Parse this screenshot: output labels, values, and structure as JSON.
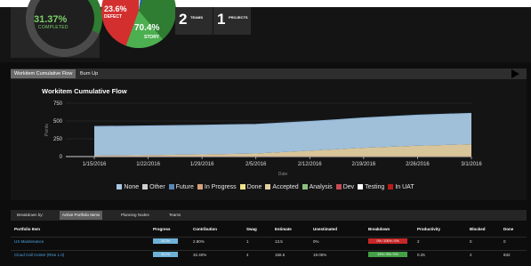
{
  "summary": {
    "gauge": {
      "value": "31.37%",
      "label": "COMPLETED"
    },
    "pie": {
      "slices": [
        {
          "name": "defect",
          "value": "23.6%",
          "label": "DEFECT",
          "color": "#d32f2f"
        },
        {
          "name": "story",
          "value": "70.4%",
          "label": "STORY",
          "color": "#4caf50"
        }
      ]
    },
    "tiles": [
      {
        "num": "2",
        "label": "TEAMS"
      },
      {
        "num": "1",
        "label": "PROJECTS"
      }
    ]
  },
  "chart_tabs": [
    "Workitem Cumulative Flow",
    "Burn Up"
  ],
  "chart_data": {
    "type": "area",
    "title": "Workitem Cumulative Flow",
    "xlabel": "Date",
    "ylabel": "Points",
    "ylim": [
      0,
      750
    ],
    "yticks": [
      0,
      250,
      500,
      750
    ],
    "x": [
      "1/15/2016",
      "1/22/2016",
      "1/29/2016",
      "2/5/2016",
      "2/12/2016",
      "2/19/2016",
      "2/26/2016",
      "3/1/2016"
    ],
    "series": [
      {
        "name": "None",
        "color": "#a8c8e4",
        "values": [
          410,
          410,
          410,
          410,
          410,
          420,
          430,
          435
        ]
      },
      {
        "name": "Other",
        "color": "#cfcfcf",
        "values": [
          0,
          0,
          0,
          0,
          0,
          0,
          0,
          0
        ]
      },
      {
        "name": "Future",
        "color": "#5a86b8",
        "values": [
          0,
          0,
          0,
          0,
          0,
          0,
          0,
          0
        ]
      },
      {
        "name": "In Progress",
        "color": "#d7a17a",
        "values": [
          0,
          0,
          0,
          0,
          0,
          0,
          0,
          0
        ]
      },
      {
        "name": "Done",
        "color": "#efe08a",
        "values": [
          0,
          0,
          0,
          0,
          0,
          0,
          0,
          0
        ]
      },
      {
        "name": "Accepted",
        "color": "#e3cfa0",
        "values": [
          10,
          18,
          28,
          40,
          80,
          120,
          150,
          170
        ]
      },
      {
        "name": "Analysis",
        "color": "#8ec07c",
        "values": [
          0,
          0,
          0,
          0,
          0,
          0,
          0,
          0
        ]
      },
      {
        "name": "Dev",
        "color": "#c64b53",
        "values": [
          0,
          0,
          0,
          0,
          0,
          0,
          0,
          0
        ]
      },
      {
        "name": "Testing",
        "color": "#ffffff",
        "values": [
          0,
          0,
          0,
          0,
          0,
          0,
          0,
          0
        ]
      },
      {
        "name": "In UAT",
        "color": "#b71c1c",
        "values": [
          3,
          3,
          3,
          3,
          3,
          3,
          3,
          3
        ]
      }
    ],
    "legend_position": "bottom",
    "grid": true
  },
  "breakdown": {
    "label": "Breakdown by:",
    "tabs": [
      "Active Portfolio Items",
      "Planning Nodes",
      "Teams"
    ],
    "active_index": 0
  },
  "table": {
    "headers": [
      "Portfolio Item",
      "Progress",
      "Contribution",
      "Swag",
      "Estimate",
      "Unestimated",
      "Breakdown",
      "Productivity",
      "Blocked",
      "Done"
    ],
    "rows": [
      {
        "item": "UX Maintenance",
        "progress": "16.3%",
        "contribution": "2.80%",
        "swag": "1",
        "estimate": "13.5",
        "unestimated": "0%",
        "breakdown": "0% / 100% / 0%",
        "breakdown_color": "#c62828",
        "productivity": "2",
        "blocked": "0",
        "done": "0"
      },
      {
        "item": "Cloud Call Center (Rise 1.0)",
        "progress": "34.1%",
        "contribution": "32.40%",
        "swag": "4",
        "estimate": "156.5",
        "unestimated": "19.05%",
        "breakdown": "91% / 8% / 0%",
        "breakdown_color": "#43a047",
        "productivity": "0.25",
        "blocked": "2",
        "done": "832"
      }
    ]
  }
}
